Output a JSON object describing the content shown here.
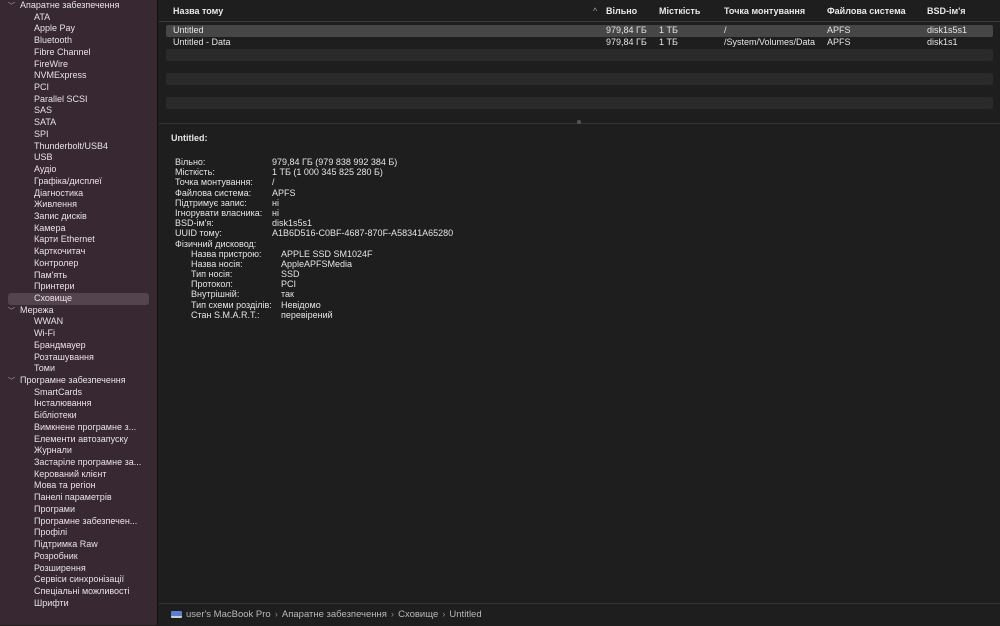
{
  "sidebar": {
    "groups": [
      {
        "label": "Апаратне забезпечення",
        "items": [
          "ATA",
          "Apple Pay",
          "Bluetooth",
          "Fibre Channel",
          "FireWire",
          "NVMExpress",
          "PCI",
          "Parallel SCSI",
          "SAS",
          "SATA",
          "SPI",
          "Thunderbolt/USB4",
          "USB",
          "Аудіо",
          "Графіка/дисплеї",
          "Діагностика",
          "Живлення",
          "Запис дисків",
          "Камера",
          "Карти Ethernet",
          "Карткочитач",
          "Контролер",
          "Пам'ять",
          "Принтери",
          "Сховище"
        ]
      },
      {
        "label": "Мережа",
        "items": [
          "WWAN",
          "Wi-Fi",
          "Брандмауер",
          "Розташування",
          "Томи"
        ]
      },
      {
        "label": "Програмне забезпечення",
        "items": [
          "SmartCards",
          "Інсталювання",
          "Бібліотеки",
          "Вимкнене програмне з...",
          "Елементи автозапуску",
          "Журнали",
          "Застаріле програмне за...",
          "Керований клієнт",
          "Мова та регіон",
          "Панелі параметрів",
          "Програми",
          "Програмне забезпечен...",
          "Профілі",
          "Підтримка Raw",
          "Розробник",
          "Розширення",
          "Сервіси синхронізації",
          "Спеціальні можливості",
          "Шрифти"
        ]
      }
    ],
    "selected": "Сховище"
  },
  "table": {
    "columns": [
      "Назва тому",
      "Вільно",
      "Місткість",
      "Точка монтування",
      "Файлова система",
      "BSD-ім'я"
    ],
    "rows": [
      [
        "Untitled",
        "979,84 ГБ",
        "1 ТБ",
        "/",
        "APFS",
        "disk1s5s1"
      ],
      [
        "Untitled - Data",
        "979,84 ГБ",
        "1 ТБ",
        "/System/Volumes/Data",
        "APFS",
        "disk1s1"
      ]
    ]
  },
  "detail": {
    "title": "Untitled:",
    "fields": [
      [
        "Вільно:",
        "979,84 ГБ (979 838 992 384 Б)"
      ],
      [
        "Місткість:",
        "1 ТБ (1 000 345 825 280 Б)"
      ],
      [
        "Точка монтування:",
        "/"
      ],
      [
        "Файлова система:",
        "APFS"
      ],
      [
        "Підтримує запис:",
        "ні"
      ],
      [
        "Ігнорувати власника:",
        "ні"
      ],
      [
        "BSD-ім'я:",
        "disk1s5s1"
      ],
      [
        "UUID тому:",
        "A1B6D516-C0BF-4687-870F-A58341A65280"
      ],
      [
        "Фізичний дисковод:",
        ""
      ]
    ],
    "sub": [
      [
        "Назва пристрою:",
        "APPLE SSD SM1024F"
      ],
      [
        "Назва носія:",
        "AppleAPFSMedia"
      ],
      [
        "Тип носія:",
        "SSD"
      ],
      [
        "Протокол:",
        "PCI"
      ],
      [
        "Внутрішній:",
        "так"
      ],
      [
        "Тип схеми розділів:",
        "Невідомо"
      ],
      [
        "Стан S.M.A.R.T.:",
        "перевірений"
      ]
    ]
  },
  "breadcrumb": [
    "user's MacBook Pro",
    "Апаратне забезпечення",
    "Сховище",
    "Untitled"
  ]
}
